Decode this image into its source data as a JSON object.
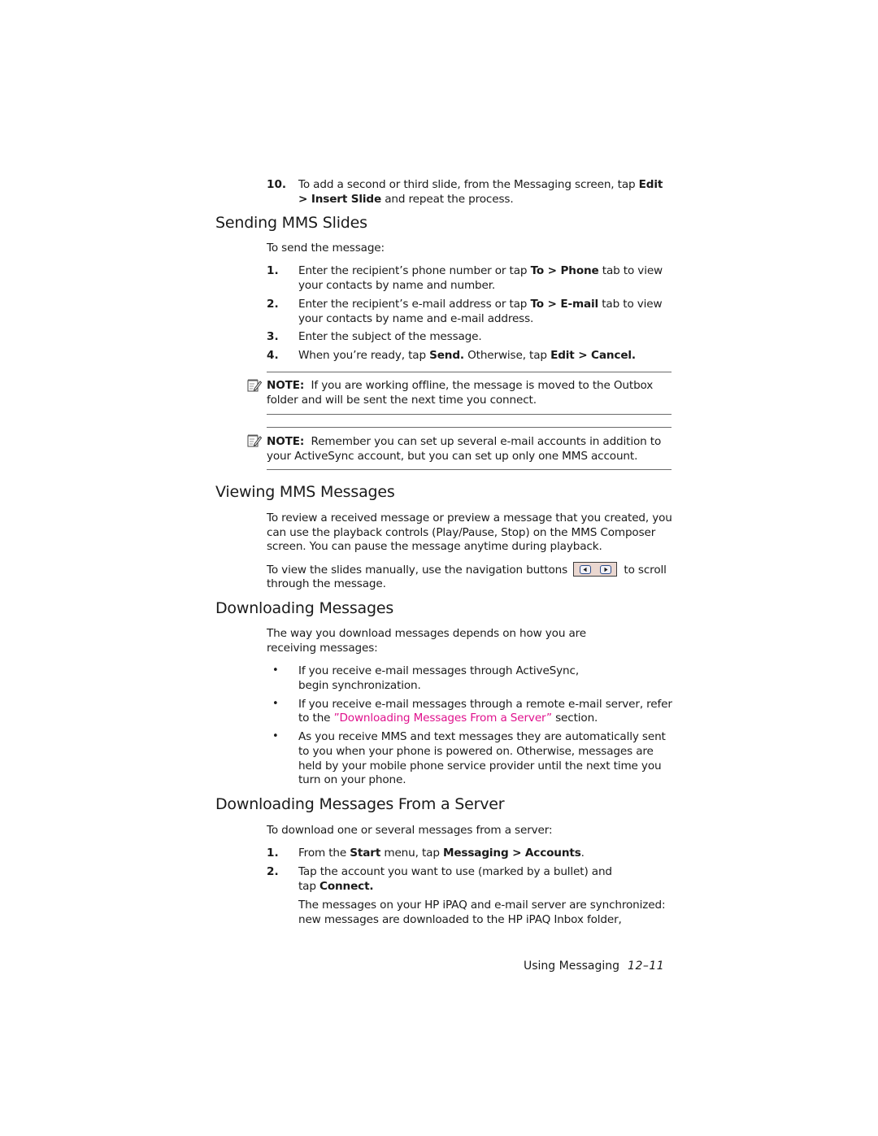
{
  "step10": {
    "number": "10.",
    "line1_prefix": "To add a second or third slide, from the Messaging screen, tap ",
    "line1_bold": "Edit",
    "line2_bold": "> Insert Slide",
    "line2_suffix": " and repeat the process."
  },
  "sending": {
    "heading": "Sending MMS Slides",
    "intro": "To send the message:",
    "steps": [
      {
        "number": "1.",
        "line1_prefix": "Enter the recipient’s phone number or tap ",
        "line1_bold": "To > Phone",
        "line1_suffix": " tab to view",
        "line2": "your contacts by name and number."
      },
      {
        "number": "2.",
        "line1_prefix": "Enter the recipient’s e-mail address or tap ",
        "line1_bold": "To > E-mail",
        "line1_suffix": " tab to view",
        "line2": "your contacts by name and e-mail address."
      },
      {
        "number": "3.",
        "line1_prefix": "Enter the subject of the message."
      },
      {
        "number": "4.",
        "line1_prefix": "When you’re ready, tap ",
        "line1_bold": "Send.",
        "line1_mid": " Otherwise, tap ",
        "line1_bold2": "Edit > Cancel."
      }
    ],
    "notes": [
      {
        "icon": "note-pencil-icon",
        "label": "NOTE:",
        "line1": "  If you are working offline, the message is moved to the Outbox",
        "line2": "folder and will be sent the next time you connect."
      },
      {
        "icon": "note-pencil-icon",
        "label": "NOTE:",
        "line1": "  Remember you can set up several e-mail accounts in addition to",
        "line2": "your ActiveSync account, but you can set up only one MMS account."
      }
    ]
  },
  "viewing": {
    "heading": "Viewing MMS Messages",
    "para1": [
      "To review a received message or preview a message that you created, you",
      "can use the playback controls (Play/Pause, Stop) on the MMS Composer",
      "screen. You can pause the message anytime during playback."
    ],
    "para2_prefix": "To view the slides manually, use the navigation buttons",
    "para2_suffix": "to scroll",
    "para2_line2": "through the message.",
    "nav_icons": [
      "previous-slide-icon",
      "next-slide-icon"
    ]
  },
  "downloading": {
    "heading": "Downloading Messages",
    "intro": [
      "The way you download messages depends on how you are",
      "receiving messages:"
    ],
    "bullets": [
      {
        "lines": [
          "If you receive e-mail messages through ActiveSync,",
          "begin synchronization."
        ]
      },
      {
        "line1": "If you receive e-mail messages through a remote e-mail server, refer",
        "line2_prefix": "to the ",
        "line2_link": "”Downloading Messages From a Server”",
        "line2_suffix": " section."
      },
      {
        "lines": [
          "As you receive MMS and text messages they are automatically sent",
          "to you when your phone is powered on. Otherwise, messages are",
          "held by your mobile phone service provider until the next time you",
          "turn on your phone."
        ]
      }
    ],
    "link_color": "#e0118d"
  },
  "server": {
    "heading": "Downloading Messages From a Server",
    "intro": "To download one or several messages from a server:",
    "steps": [
      {
        "number": "1.",
        "prefix": "From the ",
        "bold1": "Start",
        "mid": " menu, tap ",
        "bold2": "Messaging > Accounts",
        "suffix": "."
      },
      {
        "number": "2.",
        "line1": "Tap the account you want to use (marked by a bullet) and",
        "line2_prefix": "tap ",
        "line2_bold": "Connect."
      }
    ],
    "result": [
      "The messages on your HP iPAQ and e-mail server are synchronized:",
      "new messages are downloaded to the HP iPAQ Inbox folder,"
    ]
  },
  "footer": {
    "chapter": "Using Messaging",
    "page": "12–11"
  }
}
